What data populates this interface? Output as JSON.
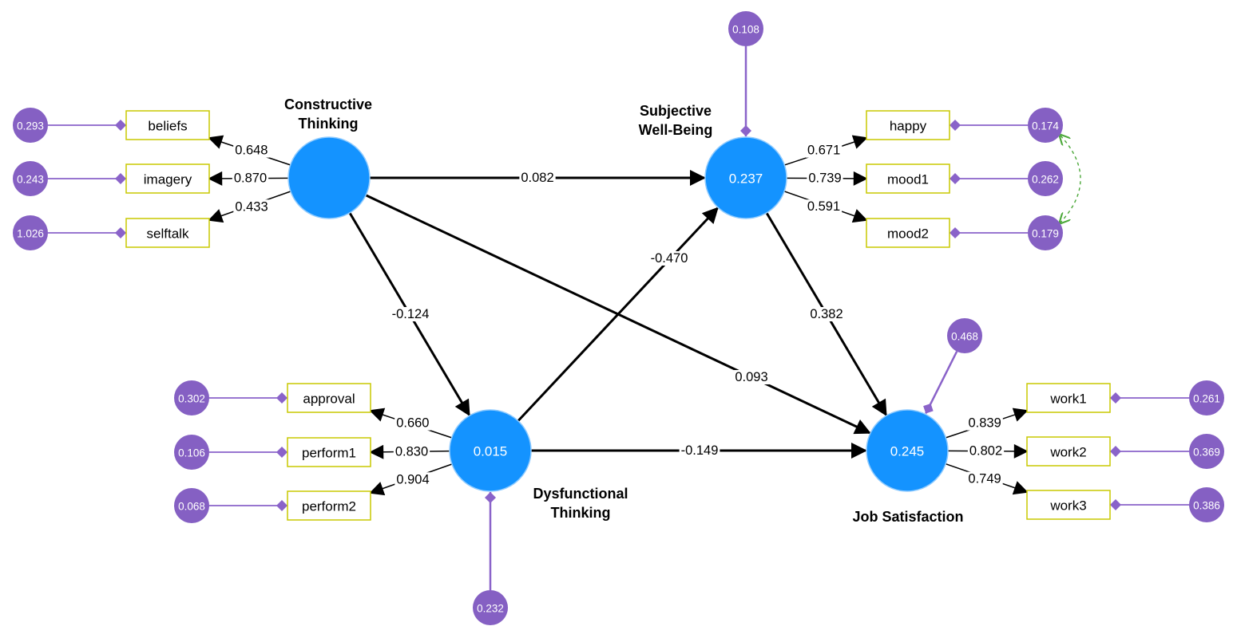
{
  "colors": {
    "latent_fill": "#1493FF",
    "latent_stroke": "#8FCBFF",
    "indicator_border": "#C8C800",
    "error_fill": "#8560C3",
    "error_line": "#8A63C9",
    "path_line": "#000000",
    "covariance_line": "#4CA83A"
  },
  "latent_variables": [
    {
      "id": "CT",
      "label_lines": [
        "Constructive",
        "Thinking"
      ],
      "r2": ""
    },
    {
      "id": "SWB",
      "label_lines": [
        "Subjective",
        "Well-Being"
      ],
      "r2": "0.237",
      "error_variance": "0.108"
    },
    {
      "id": "DT",
      "label_lines": [
        "Dysfunctional",
        "Thinking"
      ],
      "r2": "0.015",
      "error_variance": "0.232"
    },
    {
      "id": "JS",
      "label_lines": [
        "Job Satisfaction"
      ],
      "r2": "0.245",
      "error_variance": "0.468"
    }
  ],
  "indicators": [
    {
      "name": "beliefs",
      "latent": "CT",
      "loading": "0.648",
      "error_variance": "0.293"
    },
    {
      "name": "imagery",
      "latent": "CT",
      "loading": "0.870",
      "error_variance": "0.243"
    },
    {
      "name": "selftalk",
      "latent": "CT",
      "loading": "0.433",
      "error_variance": "1.026"
    },
    {
      "name": "happy",
      "latent": "SWB",
      "loading": "0.671",
      "error_variance": "0.174"
    },
    {
      "name": "mood1",
      "latent": "SWB",
      "loading": "0.739",
      "error_variance": "0.262"
    },
    {
      "name": "mood2",
      "latent": "SWB",
      "loading": "0.591",
      "error_variance": "0.179"
    },
    {
      "name": "approval",
      "latent": "DT",
      "loading": "0.660",
      "error_variance": "0.302"
    },
    {
      "name": "perform1",
      "latent": "DT",
      "loading": "0.830",
      "error_variance": "0.106"
    },
    {
      "name": "perform2",
      "latent": "DT",
      "loading": "0.904",
      "error_variance": "0.068"
    },
    {
      "name": "work1",
      "latent": "JS",
      "loading": "0.839",
      "error_variance": "0.261"
    },
    {
      "name": "work2",
      "latent": "JS",
      "loading": "0.802",
      "error_variance": "0.369"
    },
    {
      "name": "work3",
      "latent": "JS",
      "loading": "0.749",
      "error_variance": "0.386"
    }
  ],
  "structural_paths": [
    {
      "from": "CT",
      "to": "SWB",
      "coefficient": "0.082"
    },
    {
      "from": "CT",
      "to": "DT",
      "coefficient": "-0.124"
    },
    {
      "from": "CT",
      "to": "JS",
      "coefficient": "0.093"
    },
    {
      "from": "DT",
      "to": "SWB",
      "coefficient": "-0.470"
    },
    {
      "from": "DT",
      "to": "JS",
      "coefficient": "-0.149"
    },
    {
      "from": "SWB",
      "to": "JS",
      "coefficient": "0.382"
    }
  ],
  "covariances": [
    {
      "between": [
        "happy",
        "mood2"
      ],
      "style": "dashed"
    }
  ]
}
